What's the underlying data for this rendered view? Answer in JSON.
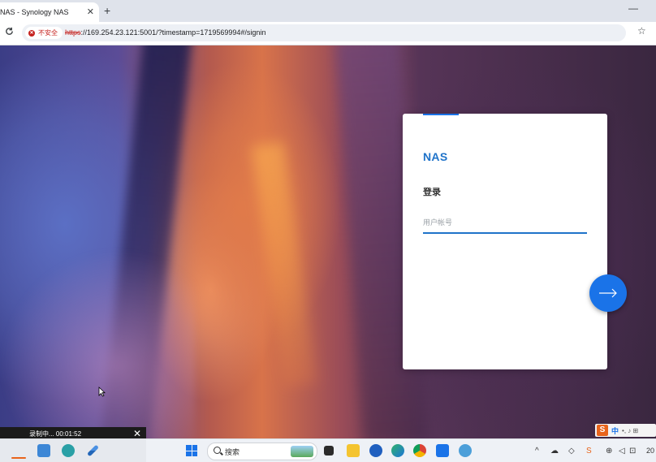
{
  "browser": {
    "tab_title": "NAS - Synology NAS",
    "new_tab_symbol": "+",
    "close_symbol": "✕",
    "minimize_symbol": "—",
    "security_label": "不安全",
    "url_scheme": "https",
    "url_rest": "://169.254.23.121:5001/?timestamp=1719569994#/signin",
    "reload_symbol": "C",
    "bookmark_symbol": "☆"
  },
  "login": {
    "brand": "NAS",
    "heading": "登录",
    "username_placeholder": "用户帐号",
    "username_value": "",
    "submit_icon": "arrow-right-icon"
  },
  "recording": {
    "status": "录制中... 00:01:52",
    "close_symbol": "✕"
  },
  "ime": {
    "logo": "S",
    "lang": "中",
    "symbols": "•, ♪ ⊞"
  },
  "taskbar": {
    "search_label": "搜索",
    "tray_clock": "20"
  },
  "colors": {
    "accent": "#1a73e8",
    "brand": "#1f73c9",
    "insecure": "#c5221f"
  }
}
